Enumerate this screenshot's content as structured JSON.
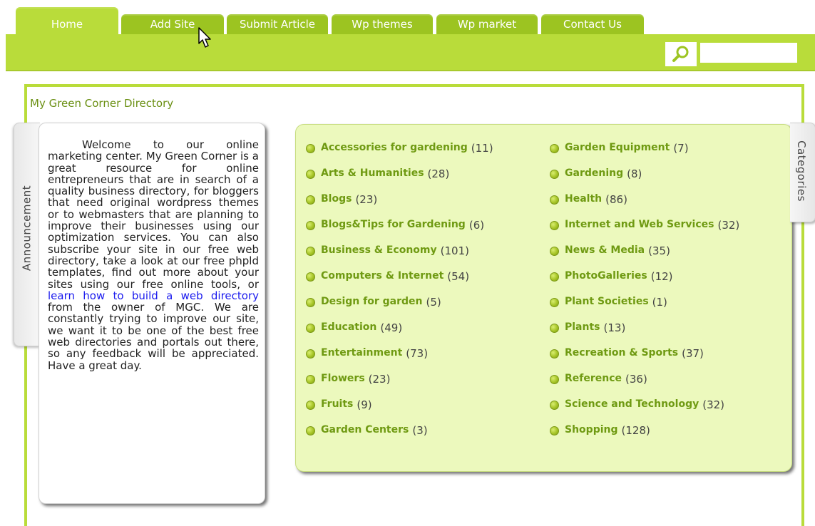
{
  "nav": {
    "tabs": [
      {
        "label": "Home"
      },
      {
        "label": "Add Site"
      },
      {
        "label": "Submit Article"
      },
      {
        "label": "Wp themes"
      },
      {
        "label": "Wp market"
      },
      {
        "label": "Contact Us"
      }
    ],
    "active_tab": "Home",
    "search_icon": "magnifier-icon",
    "search_value": ""
  },
  "site_title": "My Green Corner Directory",
  "announcement": {
    "tab_label": "Announcement",
    "text_before_link": "Welcome to our online marketing center. My Green Corner is a great resource for online entrepreneurs that are in search of a quality business directory, for bloggers that need original wordpress themes or to webmasters that are planning to improve their businesses using our optimization services. You can also subscribe your site in our free web directory, take a look at our free phpld templates, find out more about your sites using our free online tools, or ",
    "link_text": "learn how to build a web directory",
    "text_after_link": " from the owner of MGC. We are constantly trying to improve our site, we want it to be one of the best free web directories and portals out there, so any feedback will be appreciated. Have a great day."
  },
  "categories": {
    "tab_label": "Categories",
    "left": [
      {
        "name": "Accessories for gardening",
        "count": "(11)"
      },
      {
        "name": "Arts & Humanities",
        "count": "(28)"
      },
      {
        "name": "Blogs",
        "count": "(23)"
      },
      {
        "name": "Blogs&Tips for Gardening",
        "count": "(6)"
      },
      {
        "name": "Business & Economy",
        "count": "(101)"
      },
      {
        "name": "Computers & Internet",
        "count": "(54)"
      },
      {
        "name": "Design for garden",
        "count": "(5)"
      },
      {
        "name": "Education",
        "count": "(49)"
      },
      {
        "name": "Entertainment",
        "count": "(73)"
      },
      {
        "name": "Flowers",
        "count": "(23)"
      },
      {
        "name": "Fruits",
        "count": "(9)"
      },
      {
        "name": "Garden Centers",
        "count": "(3)"
      }
    ],
    "right": [
      {
        "name": "Garden Equipment",
        "count": "(7)"
      },
      {
        "name": "Gardening",
        "count": "(8)"
      },
      {
        "name": "Health",
        "count": "(86)"
      },
      {
        "name": "Internet and Web Services",
        "count": "(32)"
      },
      {
        "name": "News & Media",
        "count": "(35)"
      },
      {
        "name": "PhotoGalleries",
        "count": "(12)"
      },
      {
        "name": "Plant Societies",
        "count": "(1)"
      },
      {
        "name": "Plants",
        "count": "(13)"
      },
      {
        "name": "Recreation & Sports",
        "count": "(37)"
      },
      {
        "name": "Reference",
        "count": "(36)"
      },
      {
        "name": "Science and Technology",
        "count": "(32)"
      },
      {
        "name": "Shopping",
        "count": "(128)"
      }
    ]
  },
  "colors": {
    "accent_green": "#b9dc3a",
    "tab_green": "#9cc421",
    "category_bg": "#ecf9bd",
    "link_green": "#6f9a12",
    "link_blue": "#1a1aee"
  }
}
